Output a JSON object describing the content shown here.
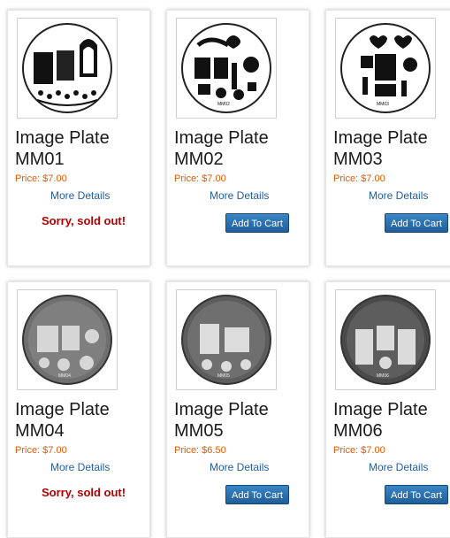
{
  "products": [
    {
      "title_line1": "Image Plate",
      "title_line2": "MM01",
      "price": "Price: $7.00",
      "details": "More Details",
      "status": "Sorry, sold out!",
      "plate_code": "MM01",
      "plate_theme": "dark",
      "watermark": "MessyMansion.com",
      "icon": "stamping-plate-icon"
    },
    {
      "title_line1": "Image Plate",
      "title_line2": "MM02",
      "price": "Price: $7.00",
      "details": "More Details",
      "cart_label": "Add To Cart",
      "plate_code": "MM02",
      "plate_theme": "light",
      "watermark": "MessyMansion.com.au",
      "icon": "stamping-plate-icon"
    },
    {
      "title_line1": "Image Plate",
      "title_line2": "MM03",
      "price": "Price: $7.00",
      "details": "More Details",
      "cart_label": "Add To Cart",
      "plate_code": "MM03",
      "plate_theme": "light",
      "watermark": "MessyMansion.com.au",
      "icon": "stamping-plate-icon"
    },
    {
      "title_line1": "Image Plate",
      "title_line2": "MM04",
      "price": "Price: $7.00",
      "details": "More Details",
      "status": "Sorry, sold out!",
      "plate_code": "MM04",
      "plate_theme": "metal",
      "watermark": "",
      "icon": "stamping-plate-icon"
    },
    {
      "title_line1": "Image Plate",
      "title_line2": "MM05",
      "price": "Price: $6.50",
      "details": "More Details",
      "cart_label": "Add To Cart",
      "plate_code": "MM05",
      "plate_theme": "metal",
      "watermark": "",
      "icon": "stamping-plate-icon"
    },
    {
      "title_line1": "Image Plate",
      "title_line2": "MM06",
      "price": "Price: $7.00",
      "details": "More Details",
      "cart_label": "Add To Cart",
      "plate_code": "MM06",
      "plate_theme": "metal",
      "watermark": "",
      "icon": "stamping-plate-icon"
    }
  ],
  "colors": {
    "price": "#e05a00",
    "link": "#1f5fa6",
    "soldout": "#b20000",
    "button": "#2d74b4"
  }
}
